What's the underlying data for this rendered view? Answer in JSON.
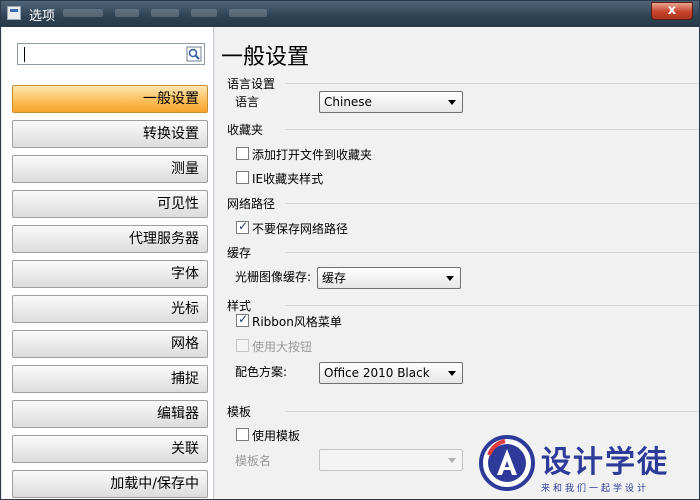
{
  "window": {
    "title": "选项",
    "close_label": "x"
  },
  "search": {
    "value": "",
    "placeholder": ""
  },
  "nav": {
    "items": [
      {
        "label": "一般设置",
        "active": true
      },
      {
        "label": "转换设置"
      },
      {
        "label": "测量"
      },
      {
        "label": "可见性"
      },
      {
        "label": "代理服务器"
      },
      {
        "label": "字体"
      },
      {
        "label": "光标"
      },
      {
        "label": "网格"
      },
      {
        "label": "捕捉"
      },
      {
        "label": "编辑器"
      },
      {
        "label": "关联"
      },
      {
        "label": "加载中/保存中"
      }
    ]
  },
  "page": {
    "title": "一般设置",
    "language_group": {
      "header": "语言设置",
      "label": "语言",
      "value": "Chinese"
    },
    "favorites_group": {
      "header": "收藏夹",
      "add_open_file": {
        "label": "添加打开文件到收藏夹",
        "checked": false
      },
      "ie_style": {
        "label": "IE收藏夹样式",
        "checked": false
      }
    },
    "network_group": {
      "header": "网络路径",
      "no_save": {
        "label": "不要保存网络路径",
        "checked": true
      }
    },
    "cache_group": {
      "header": "缓存",
      "label": "光栅图像缓存:",
      "value": "缓存"
    },
    "style_group": {
      "header": "样式",
      "ribbon": {
        "label": "Ribbon风格菜单",
        "checked": true
      },
      "large_buttons": {
        "label": "使用大按钮",
        "checked": false,
        "disabled": true
      },
      "scheme_label": "配色方案:",
      "scheme_value": "Office 2010 Black"
    },
    "template_group": {
      "header": "模板",
      "use_template": {
        "label": "使用模板",
        "checked": false
      },
      "name_label": "模板名",
      "name_value": ""
    }
  },
  "watermark": {
    "text": "设计学徒",
    "sub": "来和我们一起学设计"
  },
  "colors": {
    "accent": "#f8a42c",
    "titlebar": "#2f4254",
    "close": "#c7432a",
    "watermark": "#2d3a9a"
  }
}
